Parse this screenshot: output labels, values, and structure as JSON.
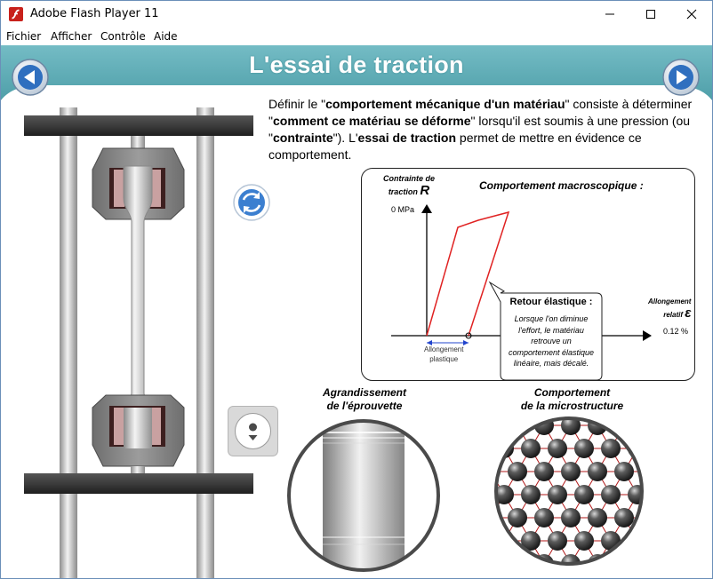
{
  "window": {
    "title": "Adobe Flash Player 11"
  },
  "menu": [
    "Fichier",
    "Afficher",
    "Contrôle",
    "Aide"
  ],
  "colors": {
    "banner": "#5aabb5",
    "accent": "#cc3333",
    "nav_blue": "#2f6fbf"
  },
  "header": {
    "title": "L'essai de traction"
  },
  "icons": {
    "prev": "left-arrow-icon",
    "next": "right-arrow-icon",
    "restart": "refresh-icon",
    "play": "play-icon",
    "app": "flash-icon"
  },
  "intro": {
    "t1": "Définir le \"",
    "b1": "comportement mécanique d'un matériau",
    "t2": "\" consiste à déterminer \"",
    "b2": "comment ce matériau se déforme",
    "t3": "\" lorsqu'il est soumis à une pression (ou \"",
    "b3": "contrainte",
    "t4": "\"). L'",
    "b4": "essai de traction",
    "t5": " permet de mettre en évidence ce comportement."
  },
  "chart": {
    "title": "Comportement macroscopique :",
    "ylabel_line1": "Contrainte de",
    "ylabel_line2": "traction",
    "ylabel_symbol": "R",
    "y_tick": "0 MPa",
    "xlabel_line1": "Allongement",
    "xlabel_line2": "relatif",
    "xlabel_symbol": "ε",
    "x_tick": "0.12 %",
    "plastic_line1": "Allongement",
    "plastic_line2": "plastique",
    "callout_title": "Retour élastique :",
    "callout_body": [
      "Lorsque l'on diminue",
      "l'effort, le matériau",
      "retrouve un",
      "comportement élastique",
      "linéaire, mais décalé."
    ]
  },
  "chart_data": {
    "type": "line",
    "title": "Comportement macroscopique :",
    "xlabel": "Allongement relatif ε",
    "ylabel": "Contrainte de traction R",
    "series": [
      {
        "points": [
          [
            0,
            0
          ],
          [
            0.045,
            0.5
          ],
          [
            0.11,
            0.57
          ],
          [
            0.06,
            0
          ]
        ]
      }
    ],
    "annotations": [
      "0 MPa",
      "0.12 %",
      "Allongement plastique",
      "Retour élastique :"
    ]
  },
  "magnify": {
    "specimen_line1": "Agrandissement",
    "specimen_line2": "de l'éprouvette",
    "micro_line1": "Comportement",
    "micro_line2": "de la microstructure"
  }
}
